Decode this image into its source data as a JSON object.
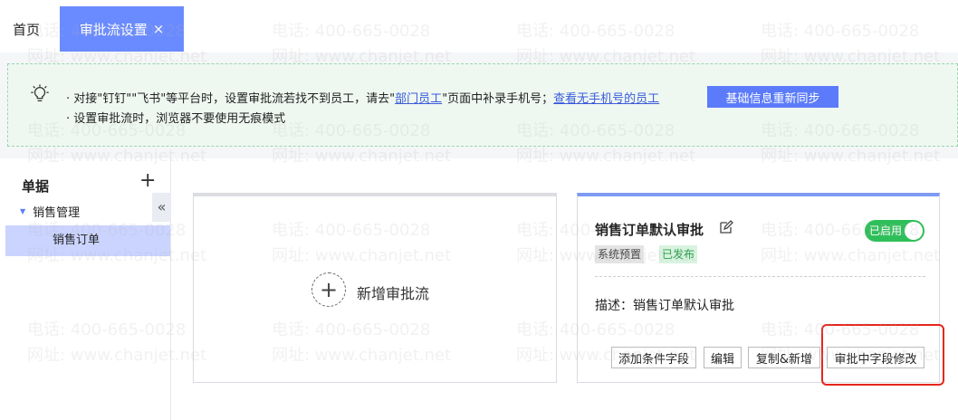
{
  "tabs": {
    "home": "首页",
    "active": "审批流设置",
    "close_glyph": "×"
  },
  "notice": {
    "line1_part1": "· 对接\"钉钉\"\"飞书\"等平台时，设置审批流若找不到员工，请去\"",
    "line1_link1": "部门员工",
    "line1_part2": "\"页面中补录手机号；",
    "line1_link2": "查看无手机号的员工",
    "line2": "· 设置审批流时，浏览器不要使用无痕模式",
    "sync_button": "基础信息重新同步"
  },
  "sidebar": {
    "title": "单据",
    "add_glyph": "+",
    "group": "销售管理",
    "item": "销售订单",
    "collapse_glyph": "«"
  },
  "new_card": {
    "plus_glyph": "+",
    "label": "新增审批流"
  },
  "flow_card": {
    "title": "销售订单默认审批",
    "toggle_label": "已启用",
    "toggle_on": true,
    "tag_preset": "系统预置",
    "tag_published": "已发布",
    "description": "描述：销售订单默认审批",
    "buttons": {
      "add_condition": "添加条件字段",
      "edit": "编辑",
      "copy_new": "复制&新增",
      "modify_fields": "审批中字段修改"
    }
  },
  "watermark": {
    "phone": "电话: 400-665-0028",
    "site": "网址: www.chanjet.net"
  },
  "colors": {
    "accent": "#5b7bfa",
    "active_tab": "#6a8bff",
    "toggle_on": "#2fbf5a",
    "highlight": "#e5261c"
  }
}
